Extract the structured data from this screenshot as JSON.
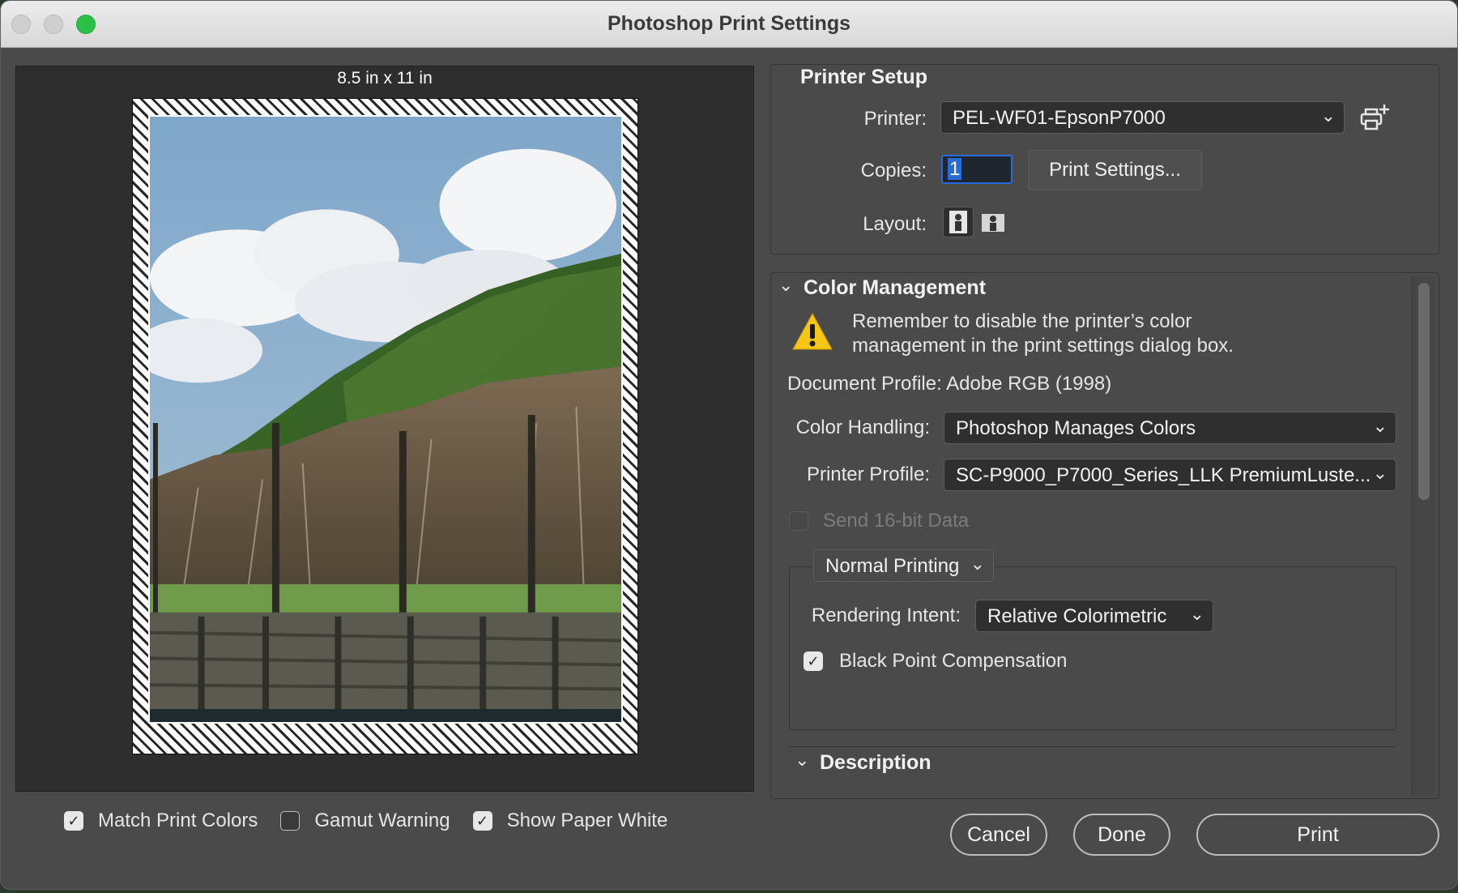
{
  "window": {
    "title": "Photoshop Print Settings"
  },
  "preview": {
    "paper_size": "8.5 in x 11 in",
    "checks": [
      {
        "label": "Match Print Colors",
        "checked": true
      },
      {
        "label": "Gamut Warning",
        "checked": false
      },
      {
        "label": "Show Paper White",
        "checked": true
      }
    ]
  },
  "printer_setup": {
    "title": "Printer Setup",
    "printer_label": "Printer:",
    "printer_value": "PEL-WF01-EpsonP7000",
    "copies_label": "Copies:",
    "copies_value": "1",
    "print_settings_button": "Print Settings...",
    "layout_label": "Layout:"
  },
  "color_management": {
    "title": "Color Management",
    "warning_line1": "Remember to disable the printer’s color",
    "warning_line2": "management in the print settings dialog box.",
    "document_profile": "Document Profile: Adobe RGB (1998)",
    "color_handling_label": "Color Handling:",
    "color_handling_value": "Photoshop Manages Colors",
    "printer_profile_label": "Printer Profile:",
    "printer_profile_value": "SC-P9000_P7000_Series_LLK PremiumLuste...",
    "send16_label": "Send 16-bit Data",
    "send16_checked": false,
    "printing_mode": "Normal Printing",
    "rendering_intent_label": "Rendering Intent:",
    "rendering_intent_value": "Relative Colorimetric",
    "bpc_label": "Black Point Compensation",
    "bpc_checked": true
  },
  "description": {
    "title": "Description"
  },
  "footer": {
    "cancel": "Cancel",
    "done": "Done",
    "print": "Print"
  },
  "colors": {
    "accent": "#2a6cd6",
    "warning": "#f5c518"
  }
}
